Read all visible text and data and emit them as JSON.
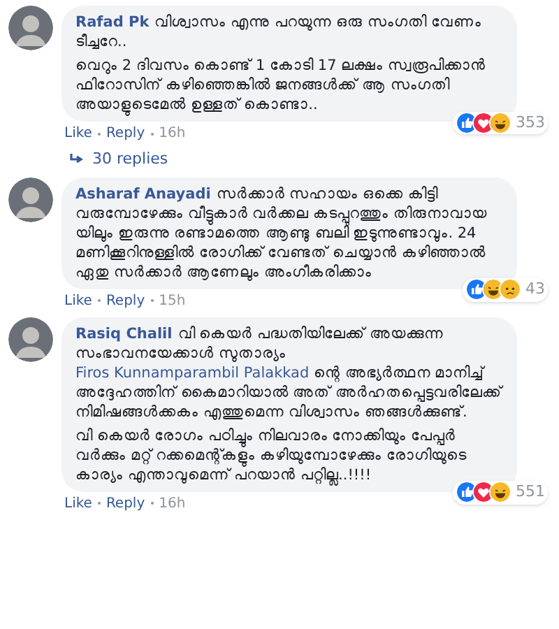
{
  "comments": [
    {
      "author": "Rafad Pk",
      "paragraphs": [
        [
          {
            "kind": "text",
            "text": "വിശ്വാസം എന്നു പറയുന്ന ഒരു സംഗതി വേണം ടീച്ചറേ.."
          }
        ],
        [
          {
            "kind": "text",
            "text": "വെറും 2 ദിവസം കൊണ്ട് 1 കോടി 17 ലക്ഷം സ്വരൂപിക്കാൻ ഫിറോസിന് കഴിഞ്ഞെങ്കിൽ ജനങ്ങൾക്ക് ആ സംഗതി അയാളുടെമേൽ ഉള്ളത് കൊണ്ടാ.."
          }
        ]
      ],
      "reactions": [
        {
          "kind": "like"
        },
        {
          "kind": "love"
        },
        {
          "kind": "haha"
        }
      ],
      "reaction_count": "353",
      "actions": [
        "Like",
        "Reply"
      ],
      "time": "16h",
      "replies": "30 replies"
    },
    {
      "author": "Asharaf Anayadi",
      "paragraphs": [
        [
          {
            "kind": "text",
            "text": "സർക്കാർ സഹായം ഒക്കെ കിട്ടി വരുമ്പോഴേക്കും വീട്ടുകാർ വർക്കല കടപ്പുറത്തും തിരുനാവായ യിലും ഇരുന്നു രണ്ടാമത്തെ ആണ്ടു ബലി ഇടുന്നുണ്ടാവും. 24 മണിക്കൂറിനുള്ളിൽ രോഗിക്ക് വേണ്ടത് ചെയ്യാൻ കഴിഞ്ഞാൽ ഏതു സർക്കാർ ആണേലും അംഗീകരിക്കാം"
          }
        ]
      ],
      "reactions": [
        {
          "kind": "like"
        },
        {
          "kind": "haha"
        },
        {
          "kind": "sad"
        }
      ],
      "reaction_count": "43",
      "actions": [
        "Like",
        "Reply"
      ],
      "time": "15h"
    },
    {
      "author": "Rasiq Chalil",
      "paragraphs": [
        [
          {
            "kind": "text",
            "text": "വി കെയർ പദ്ധതിയിലേക്ക് അയക്കുന്ന സംഭാവനയേക്കാൾ സുതാര്യം "
          },
          {
            "kind": "link",
            "text": "Firos Kunnamparambil Palakkad"
          },
          {
            "kind": "text",
            "text": " ന്റെ അഭ്യർത്ഥന മാനിച്ച് അദ്ദേഹത്തിന് കൈമാറിയാൽ അത് അർഹതപ്പെട്ടവരിലേക്ക് നിമിഷങ്ങൾക്കകം എത്തുമെന്ന വിശ്വാസം ഞങ്ങൾക്കുണ്ട്."
          }
        ],
        [
          {
            "kind": "text",
            "text": "വി കെയർ രോഗം പഠിച്ചും നിലവാരം നോക്കിയും പേപ്പർ വർക്കും മറ്റ് റക്കമെന്റ്കളും കഴിയുമ്പോഴേക്കും രോഗിയുടെ കാര്യം എന്താവുമെന്ന് പറയാൻ പറ്റില്ല..!!!!"
          }
        ]
      ],
      "reactions": [
        {
          "kind": "like"
        },
        {
          "kind": "love"
        },
        {
          "kind": "haha"
        }
      ],
      "reaction_count": "551",
      "actions": [
        "Like",
        "Reply"
      ],
      "time": "16h"
    }
  ]
}
